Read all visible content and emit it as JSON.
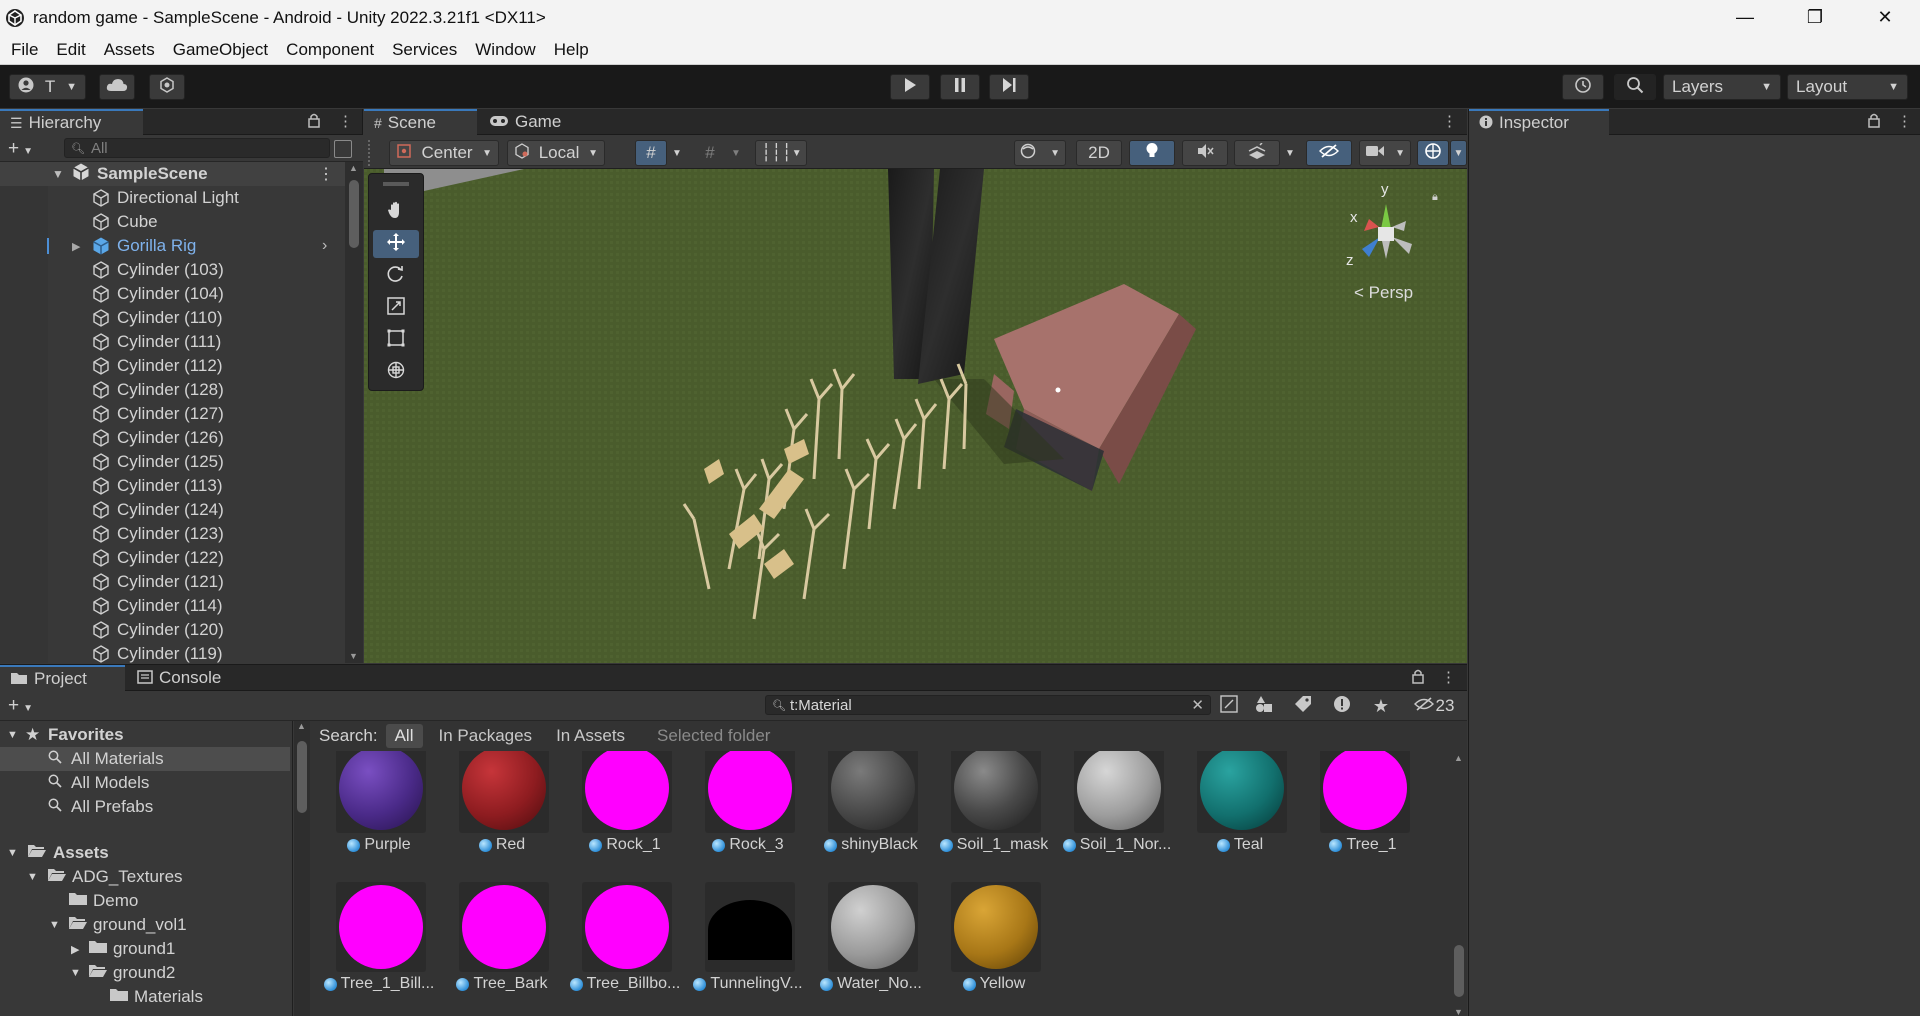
{
  "window": {
    "title": "random game - SampleScene - Android - Unity 2022.3.21f1 <DX11>",
    "minimize": "—",
    "maximize": "❐",
    "close": "✕"
  },
  "menu": [
    "File",
    "Edit",
    "Assets",
    "GameObject",
    "Component",
    "Services",
    "Window",
    "Help"
  ],
  "toolbar": {
    "account_label": "T",
    "layers_label": "Layers",
    "layout_label": "Layout"
  },
  "hierarchy": {
    "tab_label": "Hierarchy",
    "search_placeholder": "All",
    "scene_name": "SampleScene",
    "items": [
      {
        "label": "Directional Light"
      },
      {
        "label": "Cube"
      },
      {
        "label": "Gorilla Rig"
      },
      {
        "label": "Cylinder (103)"
      },
      {
        "label": "Cylinder (104)"
      },
      {
        "label": "Cylinder (110)"
      },
      {
        "label": "Cylinder (111)"
      },
      {
        "label": "Cylinder (112)"
      },
      {
        "label": "Cylinder (128)"
      },
      {
        "label": "Cylinder (127)"
      },
      {
        "label": "Cylinder (126)"
      },
      {
        "label": "Cylinder (125)"
      },
      {
        "label": "Cylinder (113)"
      },
      {
        "label": "Cylinder (124)"
      },
      {
        "label": "Cylinder (123)"
      },
      {
        "label": "Cylinder (122)"
      },
      {
        "label": "Cylinder (121)"
      },
      {
        "label": "Cylinder (114)"
      },
      {
        "label": "Cylinder (120)"
      },
      {
        "label": "Cylinder (119)"
      }
    ]
  },
  "scene": {
    "tabs": [
      "Scene",
      "Game"
    ],
    "pivot_label": "Center",
    "space_label": "Local",
    "mode_2d": "2D",
    "gizmo_x": "x",
    "gizmo_y": "y",
    "gizmo_z": "z",
    "persp_label": "< Persp"
  },
  "inspector": {
    "tab_label": "Inspector"
  },
  "project": {
    "tabs": [
      "Project",
      "Console"
    ],
    "search_value": "t:Material",
    "hidden_count": "23",
    "search_label": "Search:",
    "search_scopes": [
      "All",
      "In Packages",
      "In Assets",
      "Selected folder"
    ],
    "favorites_label": "Favorites",
    "favorites": [
      "All Materials",
      "All Models",
      "All Prefabs"
    ],
    "assets_label": "Assets",
    "folders": [
      "ADG_Textures",
      "Demo",
      "ground_vol1",
      "ground1",
      "ground2",
      "Materials"
    ],
    "materials_row1": [
      {
        "name": "Purple"
      },
      {
        "name": "Red"
      },
      {
        "name": "Rock_1"
      },
      {
        "name": "Rock_3"
      },
      {
        "name": "shinyBlack"
      },
      {
        "name": "Soil_1_mask"
      },
      {
        "name": "Soil_1_Nor..."
      },
      {
        "name": "Teal"
      },
      {
        "name": "Tree_1"
      }
    ],
    "materials_row2": [
      {
        "name": "Tree_1_Bill..."
      },
      {
        "name": "Tree_Bark"
      },
      {
        "name": "Tree_Billbo..."
      },
      {
        "name": "TunnelingV..."
      },
      {
        "name": "Water_No..."
      },
      {
        "name": "Yellow"
      }
    ]
  },
  "colors": {
    "accent_blue": "#3a79bb",
    "selected_text_blue": "#7fb2ec",
    "missing_shader_magenta": "#ff00ff"
  }
}
